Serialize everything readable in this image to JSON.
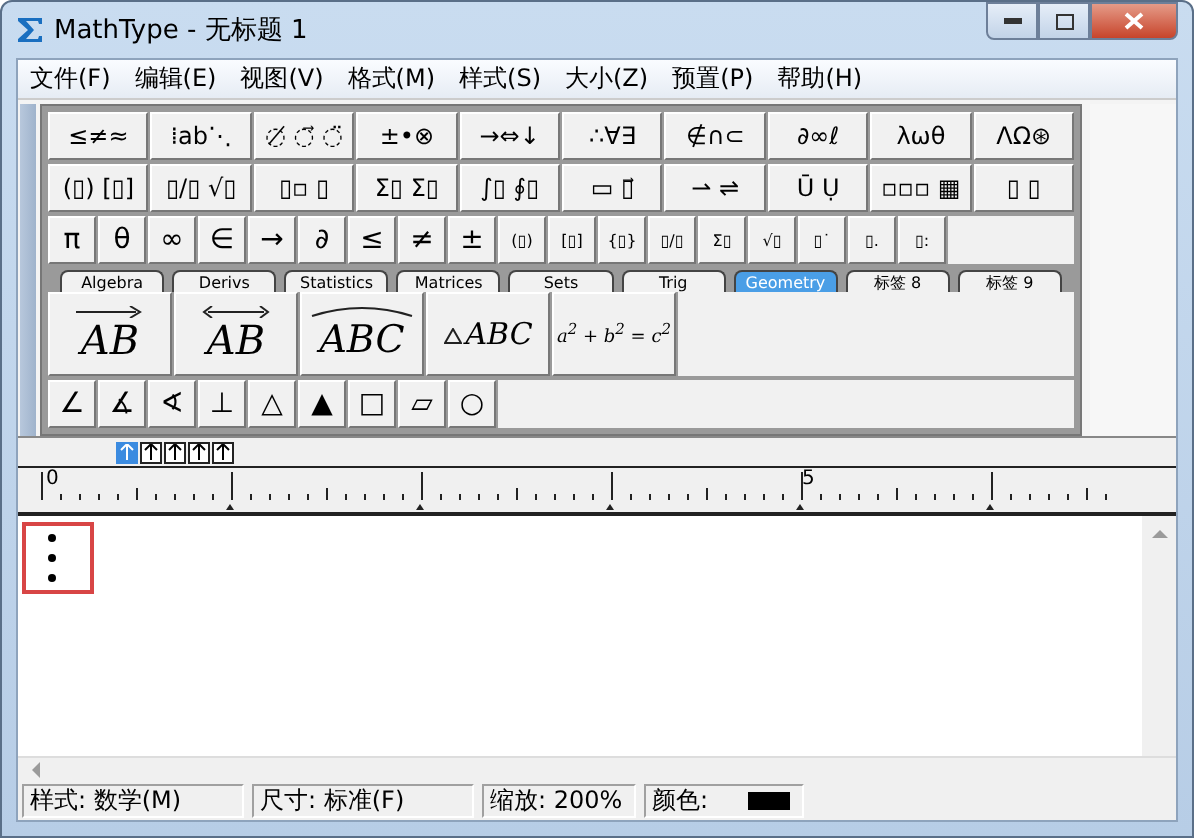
{
  "window": {
    "title": "MathType - 无标题 1"
  },
  "menu": [
    "文件(F)",
    "编辑(E)",
    "视图(V)",
    "格式(M)",
    "样式(S)",
    "大小(Z)",
    "预置(P)",
    "帮助(H)"
  ],
  "palette_rows": [
    [
      "≤≠≈",
      "⁞ab⋱",
      "◌̸ ◌⃗ ◌̈",
      "±•⊗",
      "→⇔↓",
      "∴∀∃",
      "∉∩⊂",
      "∂∞ℓ",
      "λωθ",
      "ΛΩ⊛"
    ],
    [
      "(▯) [▯]",
      "▯/▯ √▯",
      "▯▫ ▯",
      "Σ▯ Σ▯",
      "∫▯ ∮▯",
      "▭ ▯⃗",
      "⇀ ⇌",
      "Ū Ụ",
      "▫▫▫ ▦",
      "▯ ▯"
    ]
  ],
  "symbols": [
    "π",
    "θ",
    "∞",
    "∈",
    "→",
    "∂",
    "≤",
    "≠",
    "±",
    "(▯)",
    "[▯]",
    "{▯}",
    "▯/▯",
    "Σ▯",
    "√▯",
    "▯˙",
    "▯.",
    "▯:"
  ],
  "tabs": [
    {
      "label": "Algebra",
      "selected": false
    },
    {
      "label": "Derivs",
      "selected": false
    },
    {
      "label": "Statistics",
      "selected": false
    },
    {
      "label": "Matrices",
      "selected": false
    },
    {
      "label": "Sets",
      "selected": false
    },
    {
      "label": "Trig",
      "selected": false
    },
    {
      "label": "Geometry",
      "selected": true
    },
    {
      "label": "标签 8",
      "selected": false
    },
    {
      "label": "标签 9",
      "selected": false
    }
  ],
  "templates": [
    {
      "kind": "arrow",
      "text": "AB"
    },
    {
      "kind": "double_arrow",
      "text": "AB"
    },
    {
      "kind": "arc",
      "text": "ABC"
    },
    {
      "kind": "triangle",
      "text": "ABC"
    },
    {
      "kind": "plain",
      "text": "a$^{2}$ + b$^{2}$ = c$^{2}$"
    }
  ],
  "geometry_symbols": [
    "∠",
    "∡",
    "∢",
    "⊥",
    "△",
    "▲",
    "□",
    "▱",
    "○"
  ],
  "nudge_buttons": [
    {
      "selected": true
    },
    {
      "selected": false
    },
    {
      "selected": false
    },
    {
      "selected": false
    },
    {
      "selected": false
    }
  ],
  "ruler": {
    "labels": [
      "0",
      "5"
    ]
  },
  "status_bar": [
    {
      "kind": "text",
      "text": "样式: 数学(M)"
    },
    {
      "kind": "text",
      "text": "尺寸: 标准(F)"
    },
    {
      "kind": "text",
      "text": "缩放: 200%"
    },
    {
      "kind": "color",
      "text": "颜色:",
      "color": "#000000"
    }
  ]
}
